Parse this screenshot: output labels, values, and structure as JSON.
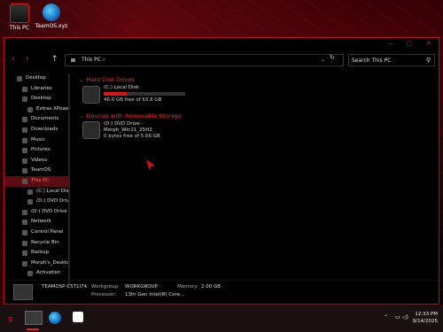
{
  "desktop": {
    "icons": [
      {
        "label": "This PC",
        "icon": "pc-icon"
      },
      {
        "label": "TeamOS.xyz",
        "icon": "edge-icon"
      }
    ]
  },
  "window": {
    "address": {
      "path": "This PC",
      "sep": "›"
    },
    "search": {
      "placeholder": "Search This PC"
    },
    "sidebar": [
      {
        "label": "Desktop",
        "indent": 0
      },
      {
        "label": "Libraries",
        "indent": 1
      },
      {
        "label": "Desktop",
        "indent": 1
      },
      {
        "label": "Extras.XPowerT",
        "indent": 2
      },
      {
        "label": "Documents",
        "indent": 1
      },
      {
        "label": "Downloads",
        "indent": 1
      },
      {
        "label": "Music",
        "indent": 1
      },
      {
        "label": "Pictures",
        "indent": 1
      },
      {
        "label": "Videos",
        "indent": 1
      },
      {
        "label": "TeamOS",
        "indent": 1
      },
      {
        "label": "This PC",
        "indent": 1,
        "selected": true
      },
      {
        "label": "(C:) Local Disk",
        "indent": 2
      },
      {
        "label": "(D:) DVD Drive",
        "indent": 2
      },
      {
        "label": "(D:) DVD Drive -",
        "indent": 1
      },
      {
        "label": "Network",
        "indent": 1
      },
      {
        "label": "Control Panel",
        "indent": 1
      },
      {
        "label": "Recycle Bin",
        "indent": 1
      },
      {
        "label": "Backup",
        "indent": 1
      },
      {
        "label": "Morph's_Deskto",
        "indent": 1
      },
      {
        "label": "Activation",
        "indent": 2
      }
    ],
    "groups": {
      "hdd": "Hard Disk Drives",
      "removable": "Devices with Removable Storage"
    },
    "drives": {
      "c": {
        "name": "(C:) Local Disk",
        "free": "46.0 GB free of 63.8 GB",
        "used_fraction": 0.28
      },
      "d": {
        "name": "(D:) DVD Drive - Morph_Win11_25H2",
        "free": "0 bytes free of 5.66 GB"
      }
    },
    "details": {
      "pc_name": "TEAMOSP-C5T1I74",
      "workgroup_label": "Workgroup:",
      "workgroup": "WORKGROUP",
      "memory_label": "Memory:",
      "memory": "2.00 GB",
      "processor_label": "Processor:",
      "processor": "13th Gen Intel(R) Core..."
    }
  },
  "taskbar": {
    "time": "12:33 PM",
    "date": "9/14/2025"
  },
  "colors": {
    "accent": "#e02030",
    "selection": "#5a0c12"
  }
}
